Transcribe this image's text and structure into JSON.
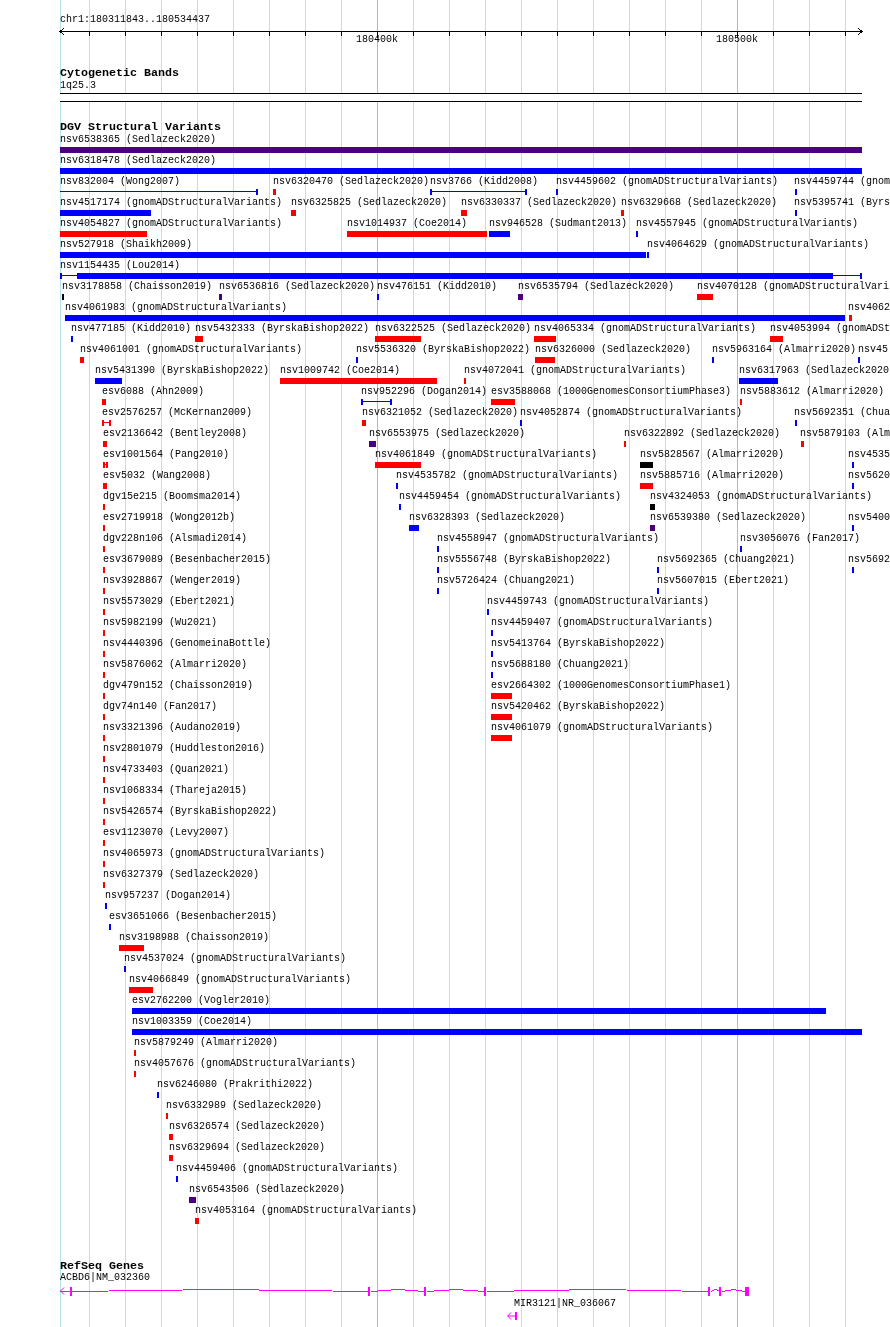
{
  "ruler": {
    "location": "chr1:180311843..180534437",
    "ticks": [
      "180400k",
      "180500k"
    ]
  },
  "tracks": [
    {
      "kind": "cytoband",
      "title": "Cytogenetic Bands",
      "features": [
        {
          "label": "1q25.3"
        }
      ]
    },
    {
      "kind": "variants",
      "title": "DGV Structural Variants",
      "features": [
        {
          "label": "nsv6538365 (Sedlazeck2020)",
          "color": "#4b0082"
        },
        {
          "label": "nsv6318478 (Sedlazeck2020)",
          "color": "#0000ff"
        },
        {
          "label": "nsv832004 (Wong2007)",
          "color": "#0000ff"
        },
        {
          "label": "nsv6320470 (Sedlazeck2020)",
          "color": "#ff0000"
        },
        {
          "label": "nsv3766 (Kidd2008)",
          "color": "#0000ff"
        },
        {
          "label": "nsv4459602 (gnomADStructuralVariants)",
          "color": "#0000ff"
        },
        {
          "label": "nsv4459744 (gnom",
          "color": "#0000ff"
        },
        {
          "label": "nsv4517174 (gnomADStructuralVariants)",
          "color": "#0000ff"
        },
        {
          "label": "nsv6325825 (Sedlazeck2020)",
          "color": "#ff0000"
        },
        {
          "label": "nsv6330337 (Sedlazeck2020)",
          "color": "#ff0000"
        },
        {
          "label": "nsv6329668 (Sedlazeck2020)",
          "color": "#ff0000"
        },
        {
          "label": "nsv5395741 (Byrs",
          "color": "#0000ff"
        },
        {
          "label": "nsv4054827 (gnomADStructuralVariants)",
          "color": "#ff0000"
        },
        {
          "label": "nsv1014937 (Coe2014)",
          "color": "#ff0000"
        },
        {
          "label": "nsv946528 (Sudmant2013)",
          "color": "#0000ff"
        },
        {
          "label": "nsv4557945 (gnomADStructuralVariants)",
          "color": "#0000ff"
        },
        {
          "label": "nsv527918 (Shaikh2009)",
          "color": "#0000ff"
        },
        {
          "label": "nsv4064629 (gnomADStructuralVariants)",
          "color": "#0000ff"
        },
        {
          "label": "nsv1154435 (Lou2014)",
          "color": "#0000ff"
        },
        {
          "label": "nsv3178858 (Chaisson2019)",
          "color": "#000000"
        },
        {
          "label": "nsv6536816 (Sedlazeck2020)",
          "color": "#4b0082"
        },
        {
          "label": "nsv476151 (Kidd2010)",
          "color": "#0000ff"
        },
        {
          "label": "nsv6535794 (Sedlazeck2020)",
          "color": "#4b0082"
        },
        {
          "label": "nsv4070128 (gnomADStructuralVari",
          "color": "#ff0000"
        },
        {
          "label": "nsv4061983 (gnomADStructuralVariants)",
          "color": "#0000ff"
        },
        {
          "label": "nsv4062",
          "color": "#ff0000"
        },
        {
          "label": "nsv477185 (Kidd2010)",
          "color": "#0000ff"
        },
        {
          "label": "nsv5432333 (ByrskaBishop2022)",
          "color": "#ff0000"
        },
        {
          "label": "nsv6322525 (Sedlazeck2020)",
          "color": "#ff0000"
        },
        {
          "label": "nsv4065334 (gnomADStructuralVariants)",
          "color": "#ff0000"
        },
        {
          "label": "nsv4053994 (gnomADSt",
          "color": "#ff0000"
        },
        {
          "label": "nsv4061001 (gnomADStructuralVariants)",
          "color": "#ff0000"
        },
        {
          "label": "nsv5536320 (ByrskaBishop2022)",
          "color": "#0000ff"
        },
        {
          "label": "nsv6326000 (Sedlazeck2020)",
          "color": "#ff0000"
        },
        {
          "label": "nsv5963164 (Almarri2020)",
          "color": "#0000ff"
        },
        {
          "label": "nsv45",
          "color": "#0000ff"
        },
        {
          "label": "nsv5431390 (ByrskaBishop2022)",
          "color": "#0000ff"
        },
        {
          "label": "nsv1009742 (Coe2014)",
          "color": "#ff0000"
        },
        {
          "label": "nsv4072041 (gnomADStructuralVariants)",
          "color": "#ff0000"
        },
        {
          "label": "nsv6317963 (Sedlazeck2020",
          "color": "#0000ff"
        },
        {
          "label": "esv6088 (Ahn2009)",
          "color": "#ff0000"
        },
        {
          "label": "nsv952296 (Dogan2014)",
          "color": "#0000ff"
        },
        {
          "label": "esv3588068 (1000GenomesConsortiumPhase3)",
          "color": "#ff0000"
        },
        {
          "label": "nsv5883612 (Almarri2020)",
          "color": "#ff0000"
        },
        {
          "label": "esv2576257 (McKernan2009)",
          "color": "#ff0000"
        },
        {
          "label": "nsv6321052 (Sedlazeck2020)",
          "color": "#ff0000"
        },
        {
          "label": "nsv4052874 (gnomADStructuralVariants)",
          "color": "#0000ff"
        },
        {
          "label": "nsv5692351 (Chua",
          "color": "#0000ff"
        },
        {
          "label": "esv2136642 (Bentley2008)",
          "color": "#ff0000"
        },
        {
          "label": "nsv6553975 (Sedlazeck2020)",
          "color": "#4b0082"
        },
        {
          "label": "nsv6322892 (Sedlazeck2020)",
          "color": "#ff0000"
        },
        {
          "label": "nsv5879103 (Alm",
          "color": "#ff0000"
        },
        {
          "label": "esv1001564 (Pang2010)",
          "color": "#ff0000"
        },
        {
          "label": "nsv4061849 (gnomADStructuralVariants)",
          "color": "#ff0000"
        },
        {
          "label": "nsv5828567 (Almarri2020)",
          "color": "#000000"
        },
        {
          "label": "nsv4535",
          "color": "#0000ff"
        },
        {
          "label": "esv5032 (Wang2008)",
          "color": "#ff0000"
        },
        {
          "label": "nsv4535782 (gnomADStructuralVariants)",
          "color": "#0000ff"
        },
        {
          "label": "nsv5885716 (Almarri2020)",
          "color": "#ff0000"
        },
        {
          "label": "nsv5620",
          "color": "#0000ff"
        },
        {
          "label": "dgv15e215 (Boomsma2014)",
          "color": "#ff0000"
        },
        {
          "label": "nsv4459454 (gnomADStructuralVariants)",
          "color": "#0000ff"
        },
        {
          "label": "nsv4324053 (gnomADStructuralVariants)",
          "color": "#000000"
        },
        {
          "label": "esv2719918 (Wong2012b)",
          "color": "#ff0000"
        },
        {
          "label": "nsv6328393 (Sedlazeck2020)",
          "color": "#0000ff"
        },
        {
          "label": "nsv6539380 (Sedlazeck2020)",
          "color": "#4b0082"
        },
        {
          "label": "nsv5400",
          "color": "#0000ff"
        },
        {
          "label": "dgv228n106 (Alsmadi2014)",
          "color": "#ff0000"
        },
        {
          "label": "nsv4558947 (gnomADStructuralVariants)",
          "color": "#0000ff"
        },
        {
          "label": "nsv3056076 (Fan2017)",
          "color": "#0000ff"
        },
        {
          "label": "esv3679089 (Besenbacher2015)",
          "color": "#ff0000"
        },
        {
          "label": "nsv5556748 (ByrskaBishop2022)",
          "color": "#0000ff"
        },
        {
          "label": "nsv5692365 (Chuang2021)",
          "color": "#0000ff"
        },
        {
          "label": "nsv5692",
          "color": "#0000ff"
        },
        {
          "label": "nsv3928867 (Wenger2019)",
          "color": "#ff0000"
        },
        {
          "label": "nsv5726424 (Chuang2021)",
          "color": "#0000ff"
        },
        {
          "label": "nsv5607015 (Ebert2021)",
          "color": "#0000ff"
        },
        {
          "label": "nsv5573029 (Ebert2021)",
          "color": "#ff0000"
        },
        {
          "label": "nsv4459743 (gnomADStructuralVariants)",
          "color": "#0000ff"
        },
        {
          "label": "nsv5982199 (Wu2021)",
          "color": "#ff0000"
        },
        {
          "label": "nsv4459407 (gnomADStructuralVariants)",
          "color": "#0000ff"
        },
        {
          "label": "nsv4440396 (GenomeinaBottle)",
          "color": "#ff0000"
        },
        {
          "label": "nsv5413764 (ByrskaBishop2022)",
          "color": "#0000ff"
        },
        {
          "label": "nsv5876062 (Almarri2020)",
          "color": "#ff0000"
        },
        {
          "label": "nsv5688180 (Chuang2021)",
          "color": "#0000ff"
        },
        {
          "label": "dgv479n152 (Chaisson2019)",
          "color": "#ff0000"
        },
        {
          "label": "esv2664302 (1000GenomesConsortiumPhase1)",
          "color": "#ff0000"
        },
        {
          "label": "dgv74n140 (Fan2017)",
          "color": "#ff0000"
        },
        {
          "label": "nsv5420462 (ByrskaBishop2022)",
          "color": "#ff0000"
        },
        {
          "label": "nsv3321396 (Audano2019)",
          "color": "#ff0000"
        },
        {
          "label": "nsv4061079 (gnomADStructuralVariants)",
          "color": "#ff0000"
        },
        {
          "label": "nsv2801079 (Huddleston2016)",
          "color": "#ff0000"
        },
        {
          "label": "nsv4733403 (Quan2021)",
          "color": "#ff0000"
        },
        {
          "label": "nsv1068334 (Thareja2015)",
          "color": "#ff0000"
        },
        {
          "label": "nsv5426574 (ByrskaBishop2022)",
          "color": "#ff0000"
        },
        {
          "label": "esv1123070 (Levy2007)",
          "color": "#ff0000"
        },
        {
          "label": "nsv4065973 (gnomADStructuralVariants)",
          "color": "#ff0000"
        },
        {
          "label": "nsv6327379 (Sedlazeck2020)",
          "color": "#ff0000"
        },
        {
          "label": "nsv957237 (Dogan2014)",
          "color": "#0000ff"
        },
        {
          "label": "esv3651066 (Besenbacher2015)",
          "color": "#0000ff"
        },
        {
          "label": "nsv3198988 (Chaisson2019)",
          "color": "#ff0000"
        },
        {
          "label": "nsv4537024 (gnomADStructuralVariants)",
          "color": "#0000ff"
        },
        {
          "label": "nsv4066849 (gnomADStructuralVariants)",
          "color": "#ff0000"
        },
        {
          "label": "esv2762200 (Vogler2010)",
          "color": "#0000ff"
        },
        {
          "label": "nsv1003359 (Coe2014)",
          "color": "#0000ff"
        },
        {
          "label": "nsv5879249 (Almarri2020)",
          "color": "#ff0000"
        },
        {
          "label": "nsv4057676 (gnomADStructuralVariants)",
          "color": "#ff0000"
        },
        {
          "label": "nsv6246080 (Prakrithi2022)",
          "color": "#0000ff"
        },
        {
          "label": "nsv6332989 (Sedlazeck2020)",
          "color": "#ff0000"
        },
        {
          "label": "nsv6326574 (Sedlazeck2020)",
          "color": "#ff0000"
        },
        {
          "label": "nsv6329694 (Sedlazeck2020)",
          "color": "#ff0000"
        },
        {
          "label": "nsv4459406 (gnomADStructuralVariants)",
          "color": "#0000ff"
        },
        {
          "label": "nsv6543506 (Sedlazeck2020)",
          "color": "#4b0082"
        },
        {
          "label": "nsv4053164 (gnomADStructuralVariants)",
          "color": "#ff0000"
        }
      ]
    },
    {
      "kind": "genes",
      "title": "RefSeq Genes",
      "features": [
        {
          "label": "ACBD6|NM_032360"
        },
        {
          "label": "MIR3121|NR_036067"
        }
      ]
    }
  ]
}
